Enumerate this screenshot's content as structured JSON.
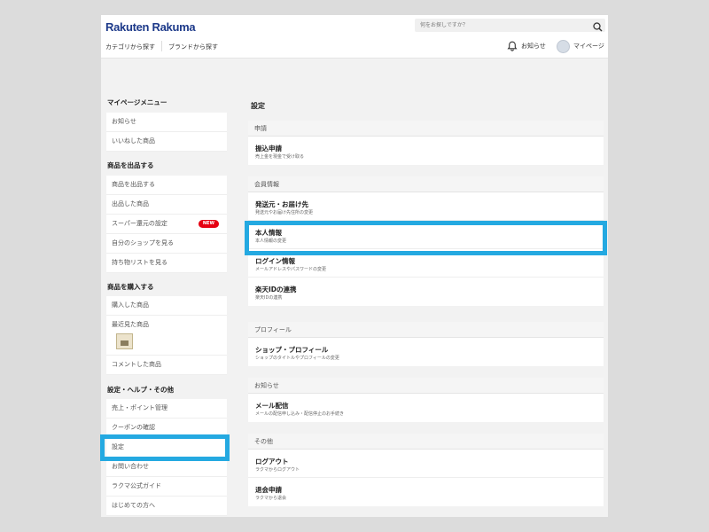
{
  "header": {
    "logo": "Rakuten Rakuma",
    "search_placeholder": "何をお探しですか？",
    "nav": [
      "カテゴリから探す",
      "ブランドから探す"
    ],
    "notifications_label": "お知らせ",
    "mypage_label": "マイページ"
  },
  "sidebar": {
    "groups": [
      {
        "title": "マイページメニュー",
        "items": [
          {
            "label": "お知らせ"
          },
          {
            "label": "いいねした商品"
          }
        ]
      },
      {
        "title": "商品を出品する",
        "items": [
          {
            "label": "商品を出品する"
          },
          {
            "label": "出品した商品"
          },
          {
            "label": "スーパー還元の設定",
            "badge": "NEW"
          },
          {
            "label": "自分のショップを見る"
          },
          {
            "label": "持ち物リストを見る"
          }
        ]
      },
      {
        "title": "商品を購入する",
        "items": [
          {
            "label": "購入した商品"
          },
          {
            "label": "最近見た商品"
          },
          {
            "label": "コメントした商品"
          }
        ]
      },
      {
        "title": "設定・ヘルプ・その他",
        "items": [
          {
            "label": "売上・ポイント管理"
          },
          {
            "label": "クーポンの確認"
          },
          {
            "label": "設定"
          },
          {
            "label": "お問い合わせ"
          },
          {
            "label": "ラクマ公式ガイド"
          },
          {
            "label": "はじめての方へ"
          }
        ]
      }
    ]
  },
  "main": {
    "title": "設定",
    "sections": [
      {
        "header": "申請",
        "rows": [
          {
            "title": "振込申請",
            "sub": "売上金を現金で受け取る"
          }
        ]
      },
      {
        "header": "会員情報",
        "rows": [
          {
            "title": "発送元・お届け先",
            "sub": "発送元やお届け先住所の変更"
          },
          {
            "title": "本人情報",
            "sub": "本人情報の変更"
          },
          {
            "title": "ログイン情報",
            "sub": "メールアドレスやパスワードの変更"
          },
          {
            "title": "楽天IDの連携",
            "sub": "楽天IDの連携"
          }
        ]
      },
      {
        "header": "プロフィール",
        "rows": [
          {
            "title": "ショップ・プロフィール",
            "sub": "ショップのタイトルやプロフィールの変更"
          }
        ]
      },
      {
        "header": "お知らせ",
        "rows": [
          {
            "title": "メール配信",
            "sub": "メールの配信申し込み・配信停止のお手続き"
          }
        ]
      },
      {
        "header": "その他",
        "rows": [
          {
            "title": "ログアウト",
            "sub": "ラクマからログアウト"
          },
          {
            "title": "退会申請",
            "sub": "ラクマから退会"
          }
        ]
      }
    ]
  },
  "colors": {
    "highlight": "#24a9e1",
    "brand": "#1d3a8a",
    "badge": "#e60012"
  }
}
